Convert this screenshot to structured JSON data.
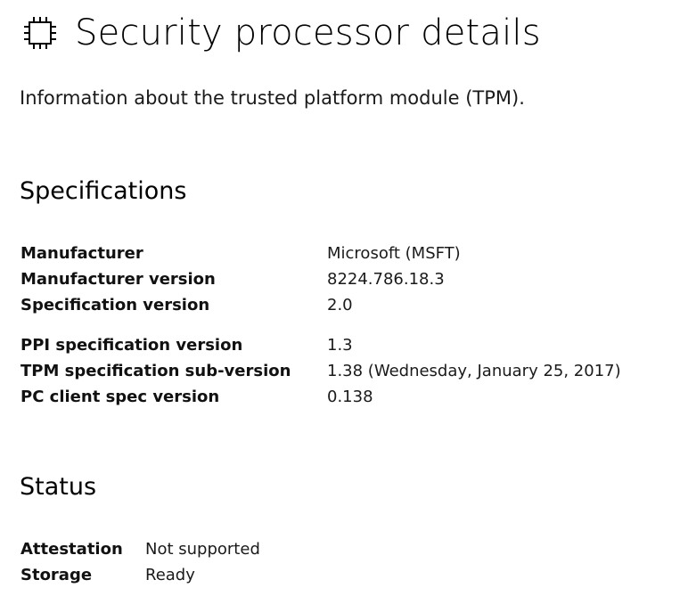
{
  "header": {
    "icon": "chip-icon",
    "title": "Security processor details"
  },
  "subtitle": "Information about the trusted platform module (TPM).",
  "specifications": {
    "title": "Specifications",
    "group1": [
      {
        "label": "Manufacturer",
        "value": "Microsoft (MSFT)"
      },
      {
        "label": "Manufacturer version",
        "value": "8224.786.18.3"
      },
      {
        "label": "Specification version",
        "value": "2.0"
      }
    ],
    "group2": [
      {
        "label": "PPI specification version",
        "value": "1.3"
      },
      {
        "label": "TPM specification sub-version",
        "value": "1.38 (Wednesday, January 25, 2017)"
      },
      {
        "label": "PC client spec version",
        "value": "0.138"
      }
    ]
  },
  "status": {
    "title": "Status",
    "items": [
      {
        "label": "Attestation",
        "value": "Not supported"
      },
      {
        "label": "Storage",
        "value": "Ready"
      }
    ]
  }
}
